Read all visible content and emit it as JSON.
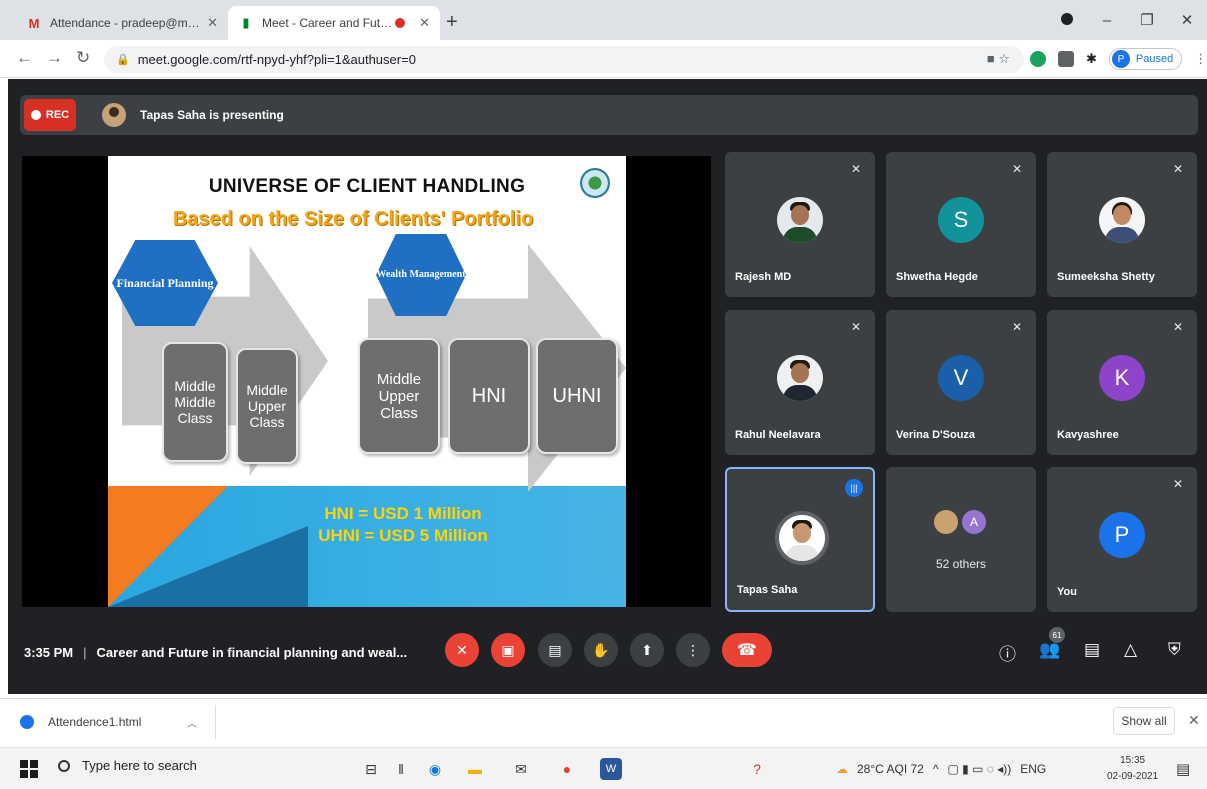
{
  "browser": {
    "tabs": [
      {
        "title": "Attendance - pradeep@mite.ac.in",
        "active": false
      },
      {
        "title": "Meet - Career and Future in",
        "active": true
      }
    ],
    "new_tab": "+",
    "window_controls": {
      "minimize": "–",
      "restore": "❐",
      "close": "✕"
    },
    "url": "meet.google.com/rtf-npyd-yhf?pli=1&authuser=0",
    "profile_initial": "P",
    "profile_status": "Paused"
  },
  "meet": {
    "rec_label": "REC",
    "presenting_text": "Tapas Saha is presenting",
    "slide": {
      "title": "UNIVERSE OF CLIENT HANDLING",
      "subtitle": "Based on the Size of Clients' Portfolio",
      "hex1": "Financial Planning",
      "hex2": "Wealth Management",
      "box1": "Middle Middle Class",
      "box2": "Middle Upper Class",
      "box3": "Middle Upper Class",
      "box4": "HNI",
      "box5": "UHNI",
      "note1": "HNI = USD 1 Million",
      "note2": "UHNI = USD 5 Million"
    },
    "participants": [
      {
        "name": "Rajesh MD",
        "initial": "",
        "muted": true
      },
      {
        "name": "Shwetha Hegde",
        "initial": "S",
        "color": "#12939a",
        "muted": true
      },
      {
        "name": "Sumeeksha Shetty",
        "initial": "",
        "muted": true
      },
      {
        "name": "Rahul Neelavara",
        "initial": "",
        "muted": true
      },
      {
        "name": "Verina D'Souza",
        "initial": "V",
        "color": "#1a5fa8",
        "muted": true
      },
      {
        "name": "Kavyashree",
        "initial": "K",
        "color": "#8e44c9",
        "muted": true
      },
      {
        "name": "Tapas Saha",
        "initial": "",
        "muted": false,
        "speaking": true
      },
      {
        "name": "",
        "initial": "",
        "others": true
      },
      {
        "name": "You",
        "initial": "P",
        "color": "#1a73e8",
        "muted": true
      }
    ],
    "others_initial": "A",
    "others_text": "52 others",
    "time": "3:35 PM",
    "meeting_title": "Career and Future in financial planning and weal...",
    "participant_count": "61"
  },
  "download": {
    "filename": "Attendence1.html",
    "show_all": "Show all"
  },
  "taskbar": {
    "search_placeholder": "Type here to search",
    "weather": "28°C  AQI 72",
    "lang": "ENG",
    "time": "15:35",
    "date": "02-09-2021"
  }
}
